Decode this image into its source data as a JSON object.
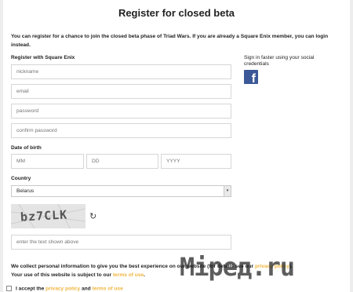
{
  "page": {
    "title": "Register for closed beta",
    "intro": "You can register for a chance to join the closed beta phase of Triad Wars. If you are already a Square Enix member, you can login instead."
  },
  "register": {
    "heading": "Register with Square Enix",
    "nickname_placeholder": "nickname",
    "email_placeholder": "email",
    "password_placeholder": "password",
    "confirm_password_placeholder": "confirm password"
  },
  "dob": {
    "label": "Date of birth",
    "mm_placeholder": "MM",
    "dd_placeholder": "DD",
    "yyyy_placeholder": "YYYY"
  },
  "country": {
    "label": "Country",
    "selected": "Belarus"
  },
  "captcha": {
    "text": "bz7CLK",
    "input_placeholder": "enter the text shown above"
  },
  "social": {
    "text": "Sign in faster using your social credentials",
    "icon": "facebook-icon",
    "brand_color": "#3b5998"
  },
  "privacy": {
    "line1": "We collect personal information to give you the best experience on our website (for details see our",
    "privacy_link": "privacy policy",
    "line1_end": ").",
    "line2": "Your use of this website is subject to our",
    "terms_link": "terms of use",
    "line2_end": "."
  },
  "accept": {
    "prefix": "I accept the",
    "privacy_link": "privacy policy",
    "and": "and",
    "terms_link": "terms of use"
  },
  "watermark": {
    "text": "Mipeд.ru"
  },
  "colors": {
    "link": "#f0b43c",
    "background": "#ededed",
    "field_border": "#d6d6d6"
  }
}
